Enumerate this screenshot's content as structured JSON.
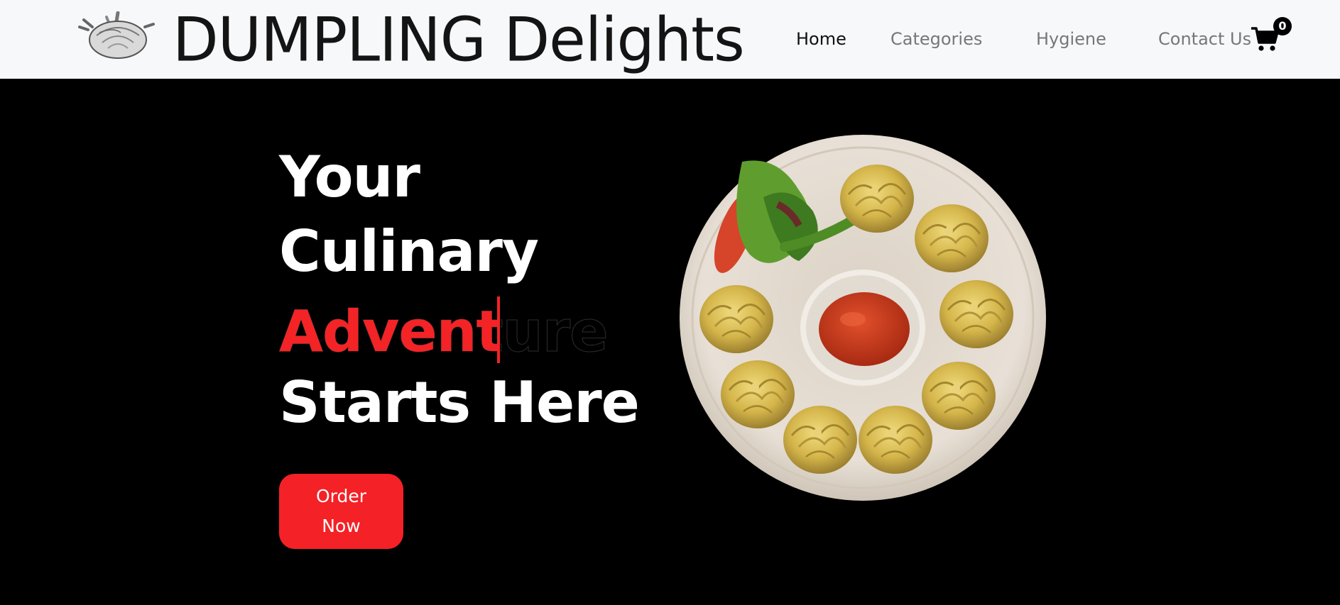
{
  "header": {
    "brand": "DUMPLING Delights",
    "logo_icon": "dumpling-logo-icon",
    "nav": {
      "home": "Home",
      "categories": "Categories",
      "hygiene": "Hygiene",
      "contact": "Contact Us"
    },
    "cart_icon": "cart-icon",
    "cart_count": "0"
  },
  "hero": {
    "line1": "Your",
    "line2": "Culinary",
    "line3_full": "Adventure",
    "line3_typed": "Adventu",
    "line4": "Starts Here",
    "order_button": "Order Now",
    "image_icon": "dumpling-plate-image"
  },
  "colors": {
    "accent": "#f42126",
    "nav_background": "#f7f8fa",
    "hero_background": "#000000",
    "nav_text": "#777777",
    "nav_active": "#111111"
  }
}
